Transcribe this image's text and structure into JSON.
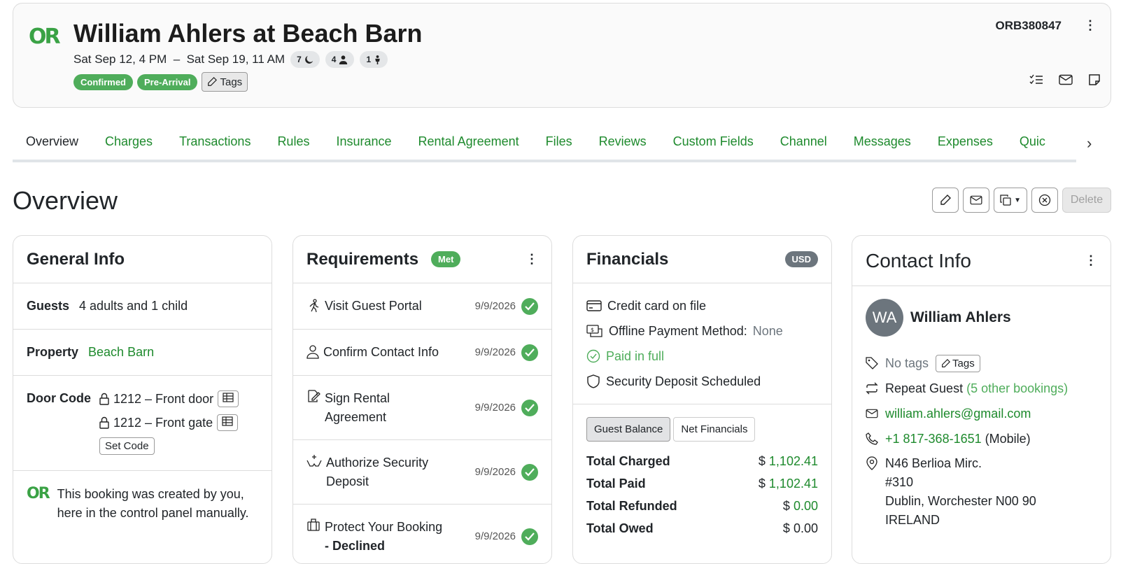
{
  "header": {
    "logo_text": "OR",
    "title": "William Ahlers at Beach Barn",
    "dates": "Sat Sep 12, 4 PM  –  Sat Sep 19, 11 AM",
    "nights": "7",
    "adults": "4",
    "children": "1",
    "status_badges": [
      "Confirmed",
      "Pre-Arrival"
    ],
    "tags_label": "Tags",
    "booking_id": "ORB380847",
    "icons": [
      "checklist-icon",
      "envelope-icon",
      "sticky-note-icon"
    ]
  },
  "tabs": [
    "Overview",
    "Charges",
    "Transactions",
    "Rules",
    "Insurance",
    "Rental Agreement",
    "Files",
    "Reviews",
    "Custom Fields",
    "Channel",
    "Messages",
    "Expenses",
    "Quic"
  ],
  "overview": {
    "title": "Overview",
    "delete_label": "Delete"
  },
  "general_info": {
    "title": "General Info",
    "guests_label": "Guests",
    "guests_value": "4 adults and 1 child",
    "property_label": "Property",
    "property_value": "Beach Barn",
    "door_code_label": "Door Code",
    "door_codes": [
      "1212 – Front door",
      "1212 – Front gate"
    ],
    "set_code_label": "Set Code",
    "created_note": "This booking was created by you, here in the control panel manually.",
    "note_logo": "OR"
  },
  "requirements": {
    "title": "Requirements",
    "status": "Met",
    "items": [
      {
        "label": "Visit Guest Portal",
        "sub": "",
        "date": "9/9/2026"
      },
      {
        "label": "Confirm Contact Info",
        "sub": "",
        "date": "9/9/2026"
      },
      {
        "label": "Sign Rental",
        "sub": "Agreement",
        "date": "9/9/2026"
      },
      {
        "label": "Authorize Security",
        "sub": "Deposit",
        "date": "9/9/2026"
      },
      {
        "label": "Protect Your Booking",
        "sub": "- Declined",
        "date": "9/9/2026"
      }
    ]
  },
  "financials": {
    "title": "Financials",
    "currency": "USD",
    "credit_card": "Credit card on file",
    "offline_label": "Offline Payment Method:",
    "offline_value": "None",
    "paid_status": "Paid in full",
    "deposit_status": "Security Deposit Scheduled",
    "toggle": [
      "Guest Balance",
      "Net Financials"
    ],
    "totals": [
      {
        "label": "Total Charged",
        "currency": "$",
        "amount": "1,102.41"
      },
      {
        "label": "Total Paid",
        "currency": "$",
        "amount": "1,102.41"
      },
      {
        "label": "Total Refunded",
        "currency": "$",
        "amount": "0.00"
      },
      {
        "label": "Total Owed",
        "currency": "$",
        "amount": "0.00"
      }
    ]
  },
  "contact": {
    "title": "Contact Info",
    "initials": "WA",
    "name": "William Ahlers",
    "no_tags": "No tags",
    "tags_label": "Tags",
    "repeat_label": "Repeat Guest",
    "repeat_link": "(5 other bookings)",
    "email": "william.ahlers@gmail.com",
    "phone": "+1 817-368-1651",
    "phone_type": "(Mobile)",
    "address_lines": [
      "N46 Berlioa Mirc.",
      "#310",
      "Dublin, Worchester N00 90",
      "IRELAND"
    ]
  }
}
